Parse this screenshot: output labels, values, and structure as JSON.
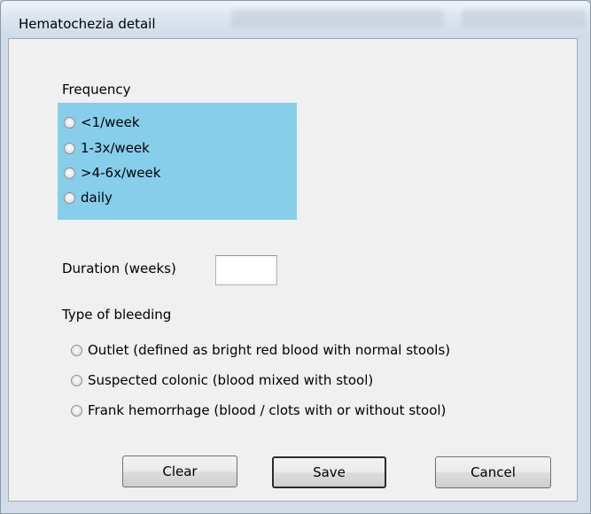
{
  "window": {
    "title": "Hematochezia detail"
  },
  "frequency": {
    "label": "Frequency",
    "options": [
      "<1/week",
      "1-3x/week",
      ">4-6x/week",
      "daily"
    ]
  },
  "duration": {
    "label": "Duration (weeks)",
    "value": ""
  },
  "bleeding": {
    "label": "Type of bleeding",
    "options": [
      "Outlet (defined as bright red blood with normal stools)",
      "Suspected colonic (blood mixed with stool)",
      "Frank hemorrhage (blood / clots with or without stool)"
    ]
  },
  "buttons": {
    "clear": "Clear",
    "save": "Save",
    "cancel": "Cancel"
  },
  "colors": {
    "frequency_panel": "#87ceeb"
  }
}
